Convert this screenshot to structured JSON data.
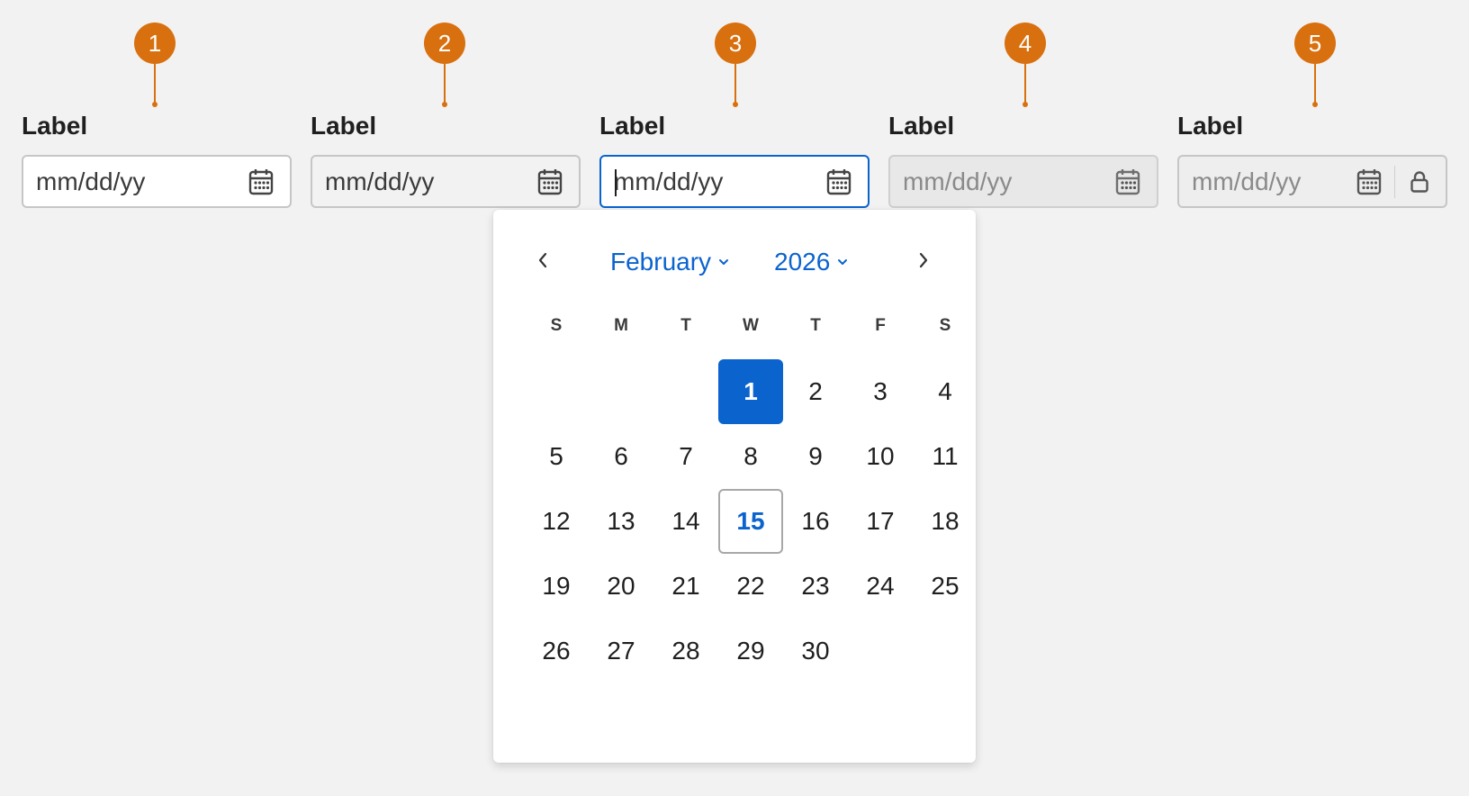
{
  "markers": [
    "1",
    "2",
    "3",
    "4",
    "5"
  ],
  "fields": [
    {
      "label": "Label",
      "placeholder": "mm/dd/yy",
      "state": "default"
    },
    {
      "label": "Label",
      "placeholder": "mm/dd/yy",
      "state": "readonly"
    },
    {
      "label": "Label",
      "placeholder": "mm/dd/yy",
      "state": "focused"
    },
    {
      "label": "Label",
      "placeholder": "mm/dd/yy",
      "state": "disabled"
    },
    {
      "label": "Label",
      "placeholder": "mm/dd/yy",
      "state": "locked"
    }
  ],
  "icons": {
    "calendar": "calendar-icon",
    "lock": "lock-icon",
    "prev": "chevron-left-icon",
    "next": "chevron-right-icon",
    "dropdown": "chevron-down-icon"
  },
  "colors": {
    "marker": "#d9700f",
    "accent": "#0b63ce",
    "background": "#f2f2f2"
  },
  "calendar": {
    "month": "February",
    "year": "2026",
    "weekdays": [
      "S",
      "M",
      "T",
      "W",
      "T",
      "F",
      "S"
    ],
    "leading_blanks": 3,
    "days": [
      "1",
      "2",
      "3",
      "4",
      "5",
      "6",
      "7",
      "8",
      "9",
      "10",
      "11",
      "12",
      "13",
      "14",
      "15",
      "16",
      "17",
      "18",
      "19",
      "20",
      "21",
      "22",
      "23",
      "24",
      "25",
      "26",
      "27",
      "28",
      "29",
      "30"
    ],
    "selected_day": "1",
    "today_day": "15"
  }
}
